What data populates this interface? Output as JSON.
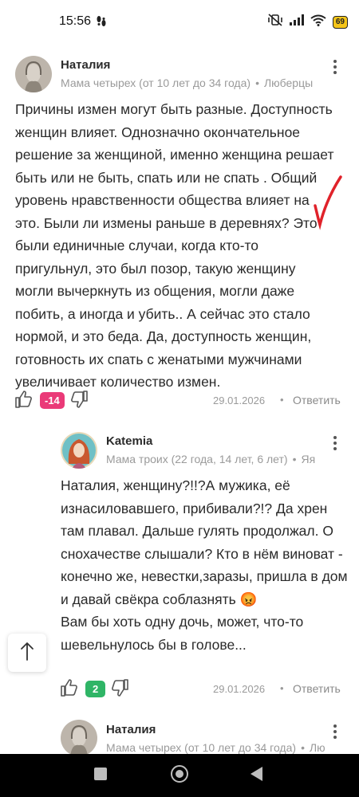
{
  "status_bar": {
    "time": "15:56",
    "steps_icon": "footsteps-icon",
    "battery": "69"
  },
  "comments": [
    {
      "author": "Наталия",
      "meta_role": "Мама четырех (от 10 лет до 34 года)",
      "meta_location": "Люберцы",
      "text": "Причины измен могут быть разные. Доступность женщин влияет. Однозначно окончательное решение за женщиной, именно женщина решает быть или не быть, спать или не спать . Общий уровень нравственности общества влияет на это. Были ли измены раньше в деревнях? Это были единичные случаи, когда кто-то пригульнул, это был позор, такую женщину могли вычеркнуть из общения, могли даже побить, а иногда и убить.. А сейчас это стало нормой, и это беда. Да, доступность женщин, готовность их спать с женатыми мужчинами увеличивает количество измен.",
      "score": "-14",
      "score_color": "#ea3a78",
      "date": "29.01.2026",
      "reply": "Ответить"
    },
    {
      "author": "Katemia",
      "meta_role": "Мама троих (22 года, 14 лет, 6 лет)",
      "meta_location": "Яя",
      "mention": "Наталия",
      "text": ", женщину?!!?А мужика, её изнасиловавшего, прибивали?!? Да хрен там плавал. Дальше гулять продолжал. О снохачестве слышали? Кто в нём виноват - конечно же, невестки,заразы, пришла в дом и давай свёкра соблазнять 😡\nВам бы хоть одну дочь, может, что-то шевельнулось бы в голове...",
      "score": "2",
      "score_color": "#2fb566",
      "date": "29.01.2026",
      "reply": "Ответить"
    },
    {
      "author": "Наталия",
      "meta_role": "Мама четырех (от 10 лет до 34 года)",
      "meta_location": "Лю"
    }
  ],
  "colors": {
    "annotation_check": "#e0222a"
  }
}
